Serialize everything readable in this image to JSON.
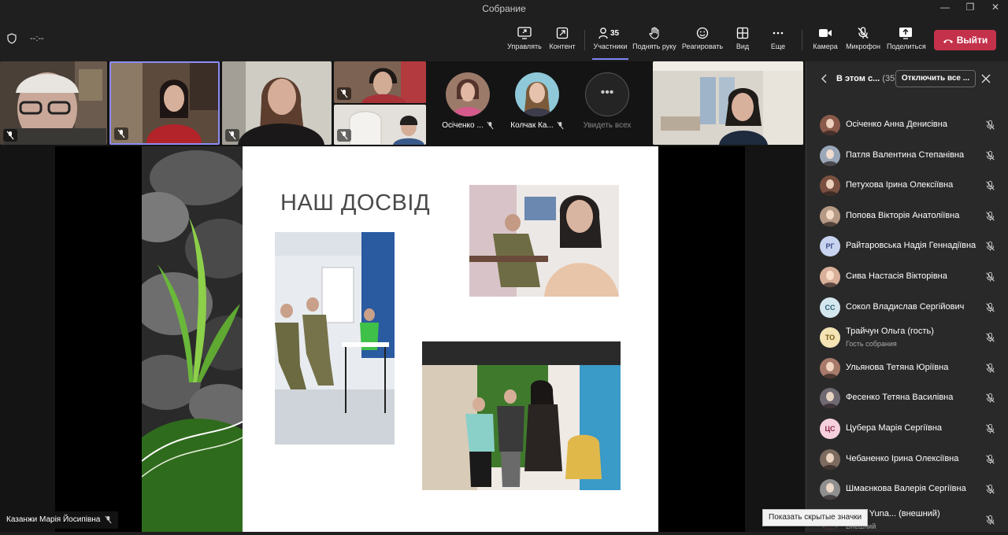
{
  "window": {
    "title": "Собрание",
    "minimize": "—",
    "maximize": "❐",
    "close": "✕"
  },
  "toolbar": {
    "timer": "--:--",
    "buttons": [
      {
        "label": "Управлять",
        "icon": "share-screen-icon"
      },
      {
        "label": "Контент",
        "icon": "content-icon"
      },
      {
        "label": "Участники",
        "icon": "people-icon",
        "count": "35",
        "active": true
      },
      {
        "label": "Поднять руку",
        "icon": "raise-hand-icon"
      },
      {
        "label": "Реагировать",
        "icon": "react-icon"
      },
      {
        "label": "Вид",
        "icon": "view-icon"
      },
      {
        "label": "Еще",
        "icon": "more-icon"
      },
      {
        "label": "Камера",
        "icon": "camera-icon"
      },
      {
        "label": "Микрофон",
        "icon": "microphone-muted-icon"
      },
      {
        "label": "Поделиться",
        "icon": "share-icon"
      }
    ],
    "leave_label": "Выйти"
  },
  "video_strip": {
    "avatars": [
      {
        "name": "Осіченко ..."
      },
      {
        "name": "Колчак Ка..."
      }
    ],
    "see_all": "Увидеть всех"
  },
  "slide": {
    "title": "НАШ ДОСВІД"
  },
  "presenter": {
    "name": "Казанжи Марія Йосипівна"
  },
  "panel": {
    "title": "В этом с...",
    "count": "(35)",
    "mute_all": "Отключить все ...",
    "participants": [
      {
        "name": "Осіченко Анна Денисівна",
        "initials": "",
        "color": "#8b5a4a"
      },
      {
        "name": "Патля Валентина Степанівна",
        "initials": "",
        "color": "#9aa7b8"
      },
      {
        "name": "Петухова Ірина Олексіївна",
        "initials": "",
        "color": "#7a5040"
      },
      {
        "name": "Попова Вікторія Анатоліївна",
        "initials": "",
        "color": "#b79a86"
      },
      {
        "name": "Райтаровська Надія Геннадіївна",
        "initials": "РГ",
        "color": "#c8d4ef",
        "text": "#3d4f8a"
      },
      {
        "name": "Сива Настасія Вікторівна",
        "initials": "",
        "color": "#d9b09a"
      },
      {
        "name": "Сокол Владислав Сергійович",
        "initials": "СС",
        "color": "#d4e6ee",
        "text": "#2c5f74"
      },
      {
        "name": "Трайчун Ольга (гость)",
        "sub": "Гость собрания",
        "initials": "ТО",
        "color": "#f3e3b5",
        "text": "#7a5b14"
      },
      {
        "name": "Ульянова Тетяна Юріївна",
        "initials": "",
        "color": "#a77a6a"
      },
      {
        "name": "Фесенко Тетяна Василівна",
        "initials": "",
        "color": "#6f6a72"
      },
      {
        "name": "Цубера Марія Сергіївна",
        "initials": "ЦС",
        "color": "#f6d0dc",
        "text": "#8a2b4f"
      },
      {
        "name": "Чебаненко Ірина Олексіївна",
        "initials": "",
        "color": "#7d6b60"
      },
      {
        "name": "Шмаєнкова Валерія Сергіївна",
        "initials": "",
        "color": "#8f8f8f"
      },
      {
        "name": "...уna Yuna... (внешний)",
        "sub": "Внешний",
        "initials": "",
        "color": "#555555"
      }
    ]
  },
  "tooltip": {
    "text": "Показать скрытые значки"
  }
}
